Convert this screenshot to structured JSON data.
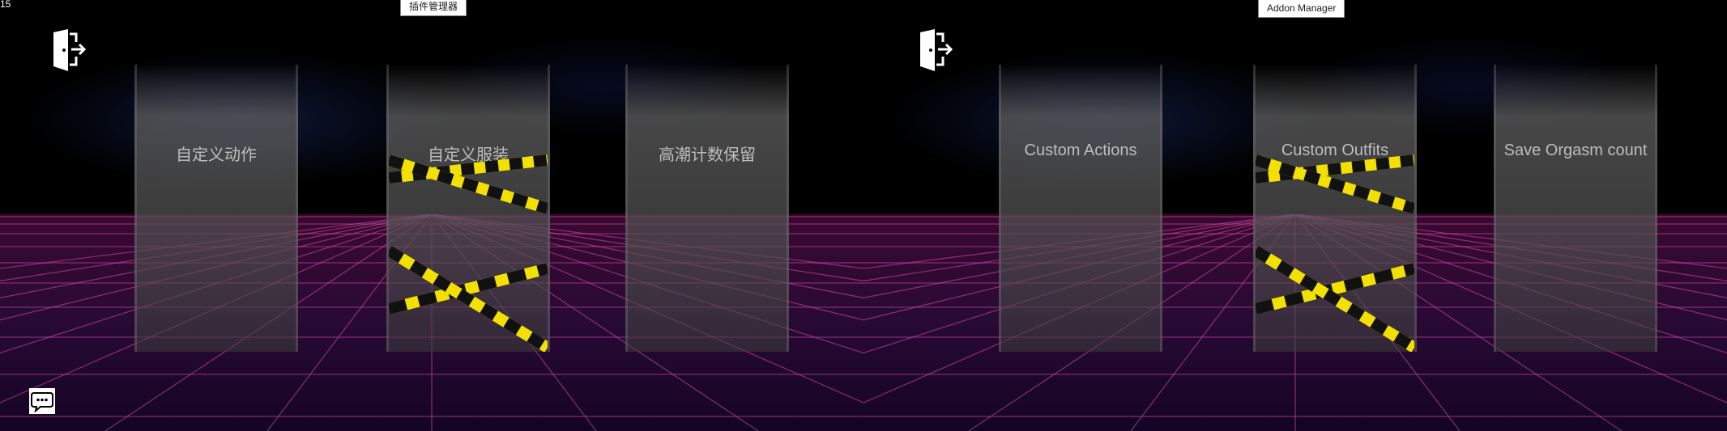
{
  "fps_counter": "15",
  "left_screen": {
    "addon_button": "插件管理器",
    "cards": [
      {
        "label": "自定义动作",
        "blocked": false
      },
      {
        "label": "自定义服装",
        "blocked": true
      },
      {
        "label": "高潮计数保留",
        "blocked": false
      }
    ]
  },
  "right_screen": {
    "addon_button": "Addon Manager",
    "cards": [
      {
        "label": "Custom Actions",
        "blocked": false
      },
      {
        "label": "Custom Outfits",
        "blocked": true
      },
      {
        "label": "Save Orgasm count",
        "blocked": false
      }
    ]
  },
  "icons": {
    "exit": "exit-door-icon",
    "chat": "chat-bubble-icon"
  },
  "colors": {
    "grid_line": "#d04aa0",
    "tape_yellow": "#f2e000",
    "tape_black": "#111111",
    "card_text": "#bdbdbd"
  }
}
